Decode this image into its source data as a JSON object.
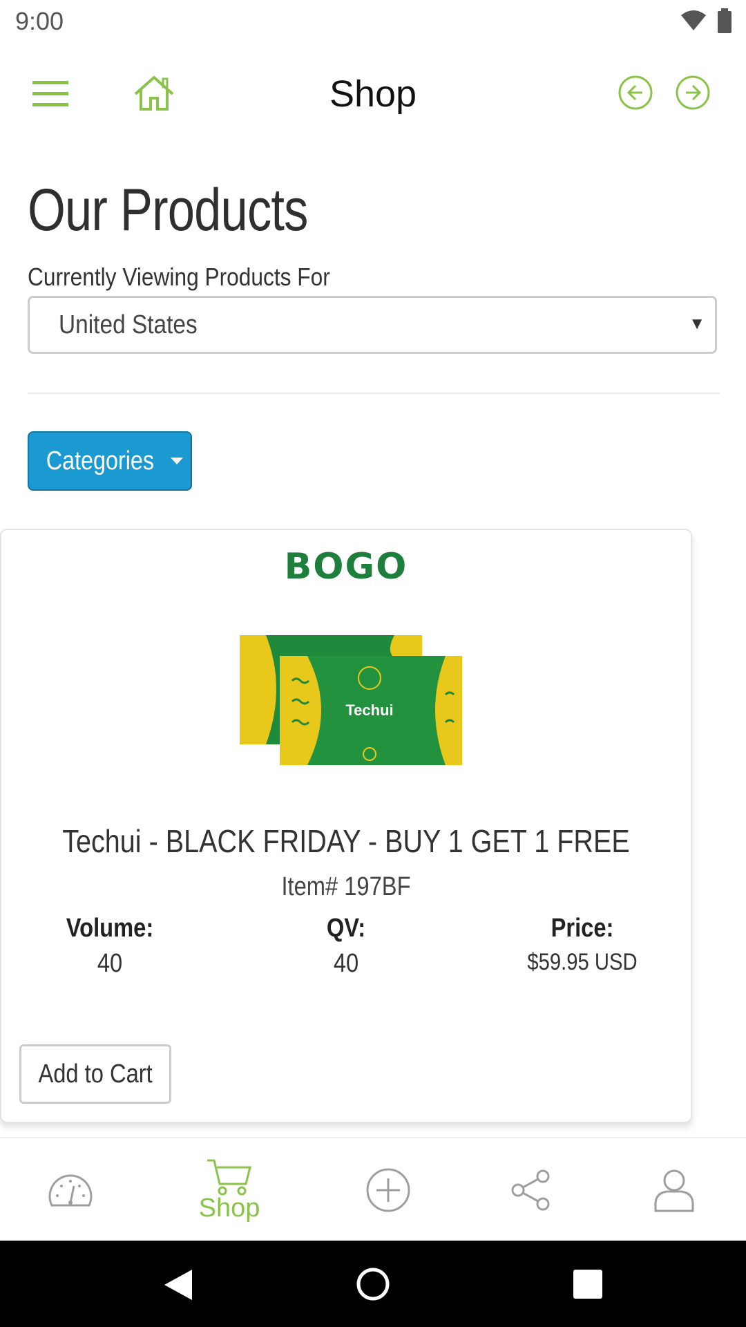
{
  "status_bar": {
    "time": "9:00"
  },
  "top_nav": {
    "title": "Shop"
  },
  "header": {
    "title": "Our Products",
    "viewing_label": "Currently Viewing Products For",
    "country_select": {
      "value": "United States"
    }
  },
  "categories_button": {
    "label": "Categories"
  },
  "product": {
    "badge": "BOGO",
    "package_text": "Techui",
    "name": "Techui - BLACK FRIDAY - BUY 1 GET 1 FREE",
    "item_number": "Item# 197BF",
    "volume_label": "Volume:",
    "volume_value": "40",
    "qv_label": "QV:",
    "qv_value": "40",
    "price_label": "Price:",
    "price_value": "$59.95 USD",
    "add_to_cart_label": "Add to Cart"
  },
  "tab_bar": {
    "active_tab": "Shop",
    "shop_label": "Shop",
    "accent_color": "#8bc34a",
    "inactive_color": "#9e9e9e"
  },
  "colors": {
    "brand_green": "#8bc34a",
    "button_blue": "#1a9ad1",
    "bogo_green": "#1e7f3c"
  }
}
